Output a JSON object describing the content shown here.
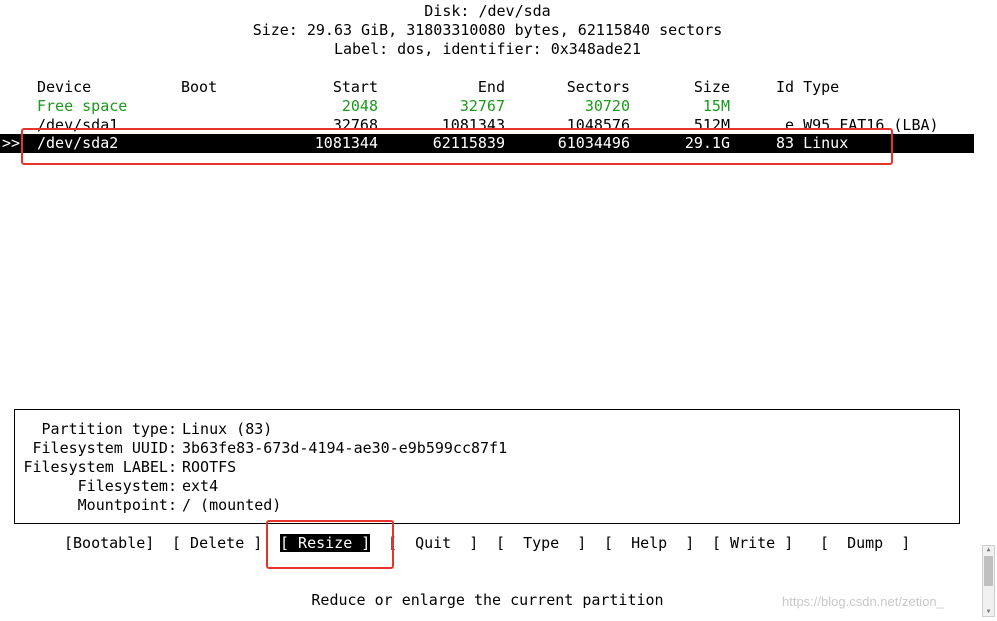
{
  "header": {
    "disk_line": "Disk: /dev/sda",
    "size_line": "Size: 29.63 GiB, 31803310080 bytes, 62115840 sectors",
    "label_line": "Label: dos, identifier: 0x348ade21"
  },
  "table": {
    "headers": {
      "device": "Device",
      "boot": "Boot",
      "start": "Start",
      "end": "End",
      "sectors": "Sectors",
      "size": "Size",
      "idtype": "Id Type"
    },
    "rows": [
      {
        "device": "Free space",
        "boot": "",
        "start": "2048",
        "end": "32767",
        "sectors": "30720",
        "size": "15M",
        "idtype": "",
        "color": "#1a9a1a"
      },
      {
        "device": "/dev/sda1",
        "boot": "",
        "start": "32768",
        "end": "1081343",
        "sectors": "1048576",
        "size": "512M",
        "idtype": " e W95 FAT16 (LBA)"
      },
      {
        "device": "/dev/sda2",
        "boot": "",
        "start": "1081344",
        "end": "62115839",
        "sectors": "61034496",
        "size": "29.1G",
        "idtype": "83 Linux",
        "selected": true
      }
    ],
    "cursor": ">>"
  },
  "info": {
    "partition_type_label": "Partition type:",
    "partition_type_value": "Linux (83)",
    "fs_uuid_label": "Filesystem UUID:",
    "fs_uuid_value": "3b63fe83-673d-4194-ae30-e9b599cc87f1",
    "fs_label_label": "Filesystem LABEL:",
    "fs_label_value": "ROOTFS",
    "filesystem_label": "Filesystem:",
    "filesystem_value": "ext4",
    "mountpoint_label": "Mountpoint:",
    "mountpoint_value": "/ (mounted)"
  },
  "menu": {
    "bootable": "[Bootable]",
    "delete": "[ Delete ]",
    "resize": "[ Resize ]",
    "quit": "[  Quit  ]",
    "type": "[  Type  ]",
    "help": "[  Help  ]",
    "write": "[ Write ]",
    "dump": "[  Dump  ]",
    "selected": "resize"
  },
  "status": "Reduce or enlarge the current partition",
  "watermark": "https://blog.csdn.net/zetion_",
  "colors": {
    "highlight_bg": "#000000",
    "highlight_fg": "#ffffff",
    "free_space": "#1a9a1a",
    "annotation_box": "#e8332a"
  }
}
